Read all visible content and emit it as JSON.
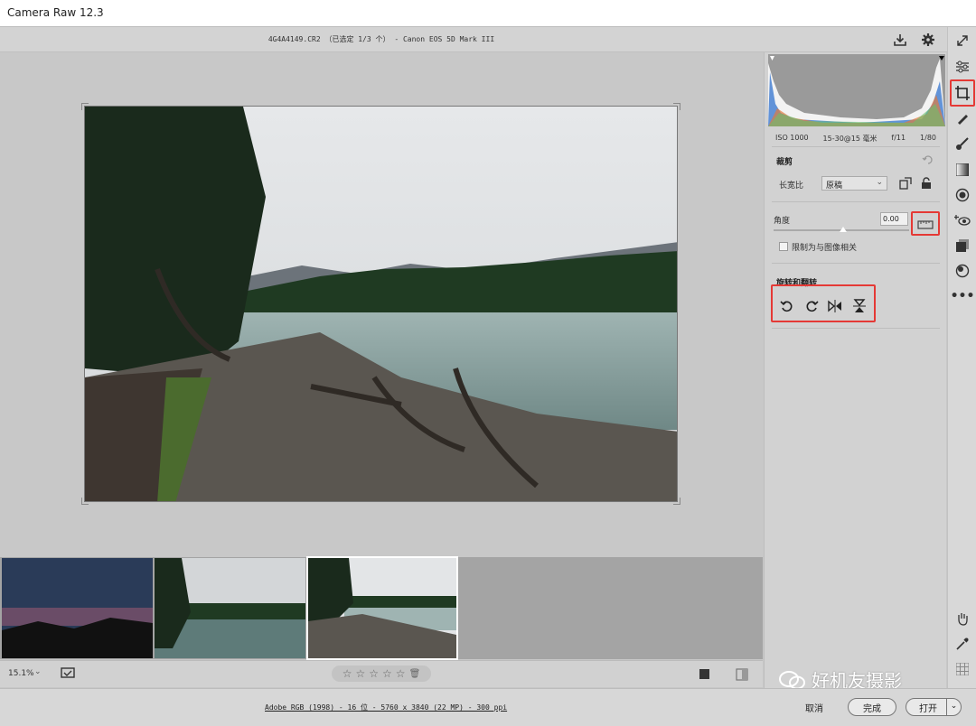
{
  "window": {
    "title": "Camera Raw 12.3"
  },
  "topbar": {
    "file_info": "4G4A4149.CR2 （已选定 1/3 个） - Canon EOS 5D Mark III"
  },
  "histogram": {
    "iso": "ISO 1000",
    "lens": "15-30@15 毫米",
    "aperture": "f/11",
    "shutter": "1/80"
  },
  "crop_panel": {
    "section_title": "裁剪",
    "aspect_label": "长宽比",
    "aspect_value": "原稿",
    "angle_label": "角度",
    "angle_value": "0.00",
    "constrain_label": "限制为与图像相关",
    "rotate_title": "旋转和翻转"
  },
  "bottombar": {
    "zoom": "15.1%",
    "stars": [
      "☆",
      "☆",
      "☆",
      "☆",
      "☆"
    ]
  },
  "statusbar": {
    "workflow": "Adobe RGB (1998) - 16 位 - 5760 x 3840 (22 MP) - 300 ppi",
    "cancel": "取消",
    "done": "完成",
    "open": "打开",
    "watermark": "好机友摄影"
  },
  "colors": {
    "highlight": "#e53935",
    "panel": "#d2d2d2"
  }
}
